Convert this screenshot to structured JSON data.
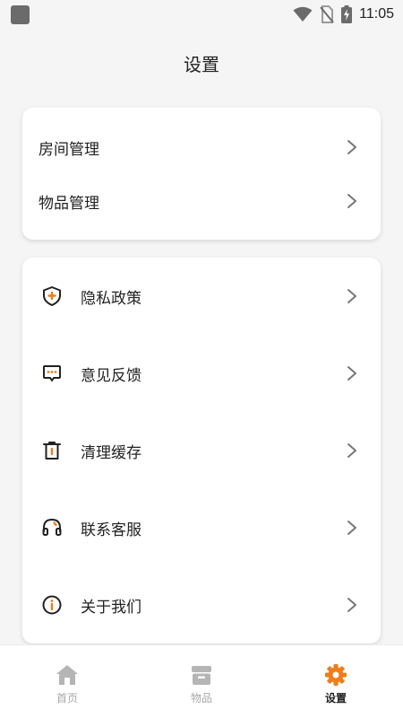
{
  "status_bar": {
    "time": "11:05"
  },
  "header": {
    "title": "设置"
  },
  "group1": {
    "items": [
      {
        "label": "房间管理"
      },
      {
        "label": "物品管理"
      }
    ]
  },
  "group2": {
    "items": [
      {
        "label": "隐私政策",
        "icon": "shield-icon"
      },
      {
        "label": "意见反馈",
        "icon": "feedback-icon"
      },
      {
        "label": "清理缓存",
        "icon": "trash-icon"
      },
      {
        "label": "联系客服",
        "icon": "headset-icon"
      },
      {
        "label": "关于我们",
        "icon": "info-icon"
      }
    ]
  },
  "bottom_nav": {
    "items": [
      {
        "label": "首页",
        "icon": "home-icon",
        "active": false
      },
      {
        "label": "物品",
        "icon": "box-icon",
        "active": false
      },
      {
        "label": "设置",
        "icon": "gear-icon",
        "active": true
      }
    ]
  },
  "colors": {
    "accent": "#f07d1a",
    "inactive": "#b5b5b5",
    "background": "#f5f5f5"
  }
}
